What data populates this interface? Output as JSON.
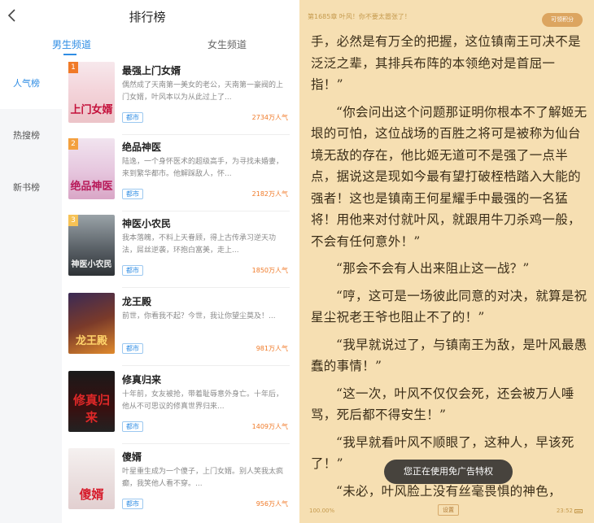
{
  "ranking": {
    "title": "排行榜",
    "channels": [
      "男生频道",
      "女生频道"
    ],
    "active_channel": "男生频道",
    "nav": [
      "人气榜",
      "热搜榜",
      "新书榜"
    ],
    "active_nav": "人气榜",
    "books": [
      {
        "rank": "1",
        "title": "最强上门女婿",
        "cover_text": "上门女婿",
        "desc": "偶然成了天南第一美女的老公，天南第一豪阀的上门女婿，叶风本以为从此过上了...",
        "tag": "都市",
        "popularity": "2734万人气"
      },
      {
        "rank": "2",
        "title": "绝品神医",
        "cover_text": "绝品神医",
        "desc": "陆逸，一个身怀医术的超级高手，为寻找未婚妻，来到繁华都市。他解踩敌人，怀...",
        "tag": "都市",
        "popularity": "2182万人气"
      },
      {
        "rank": "3",
        "title": "神医小农民",
        "cover_text": "神医小农民",
        "desc": "我本落魄，不料上天眷顾，得上古传承习逆天功法，屌丝逆袭，环抱白富美，走上...",
        "tag": "都市",
        "popularity": "1850万人气"
      },
      {
        "rank": "",
        "title": "龙王殿",
        "cover_text": "龙王殿",
        "desc": "前世，你看我不起？今世，我让你望尘莫及！...",
        "tag": "都市",
        "popularity": "981万人气"
      },
      {
        "rank": "",
        "title": "修真归来",
        "cover_text": "修真归来",
        "desc": "十年前，女友被抢，带着耻辱意外身亡。十年后，他从不可思议的修真世界归来...",
        "tag": "都市",
        "popularity": "1409万人气"
      },
      {
        "rank": "",
        "title": "傻婿",
        "cover_text": "傻婿",
        "desc": "叶星重生成为一个傻子，上门女婿。别人笑我太疯癫，我笑他人看不穿。...",
        "tag": "都市",
        "popularity": "956万人气"
      }
    ]
  },
  "reader": {
    "header": "第1685章 叶风！你不要太嚣张了！",
    "pill": "可领积分",
    "paragraphs": [
      "手，必然是有万全的把握，这位镇南王可决不是泛泛之辈，其排兵布阵的本领绝对是首屈一指！”",
      "“你会问出这个问题那证明你根本不了解姬无垠的可怕，这位战场的百胜之将可是被称为仙台境无敌的存在，他比姬无道可不是强了一点半点，据说这是现如今最有望打破桎梏踏入大能的强者！这也是镇南王何星耀手中最强的一名猛将！用他来对付就叶风，就跟用牛刀杀鸡一般，不会有任何意外！”",
      "“那会不会有人出来阻止这一战？”",
      "“哼，这可是一场彼此同意的对决，就算是祝星尘祝老王爷也阻止不了的！”",
      "“我早就说过了，与镇南王为敌，是叶风最愚蠢的事情！”",
      "“这一次，叶风不仅仅会死，还会被万人唾骂，死后都不得安生！”",
      "“我早就看叶风不顺眼了，这种人，早该死了！”",
      "“未必，叶风脸上没有丝毫畏惧的神色，"
    ],
    "toast": "您正在使用免广告特权",
    "progress": "100.00%",
    "footer_button": "设置",
    "time": "23:52"
  },
  "colors": {
    "accent": "#2f8de4",
    "reader_bg": "#f6dfb2",
    "popularity": "#f07a28"
  }
}
